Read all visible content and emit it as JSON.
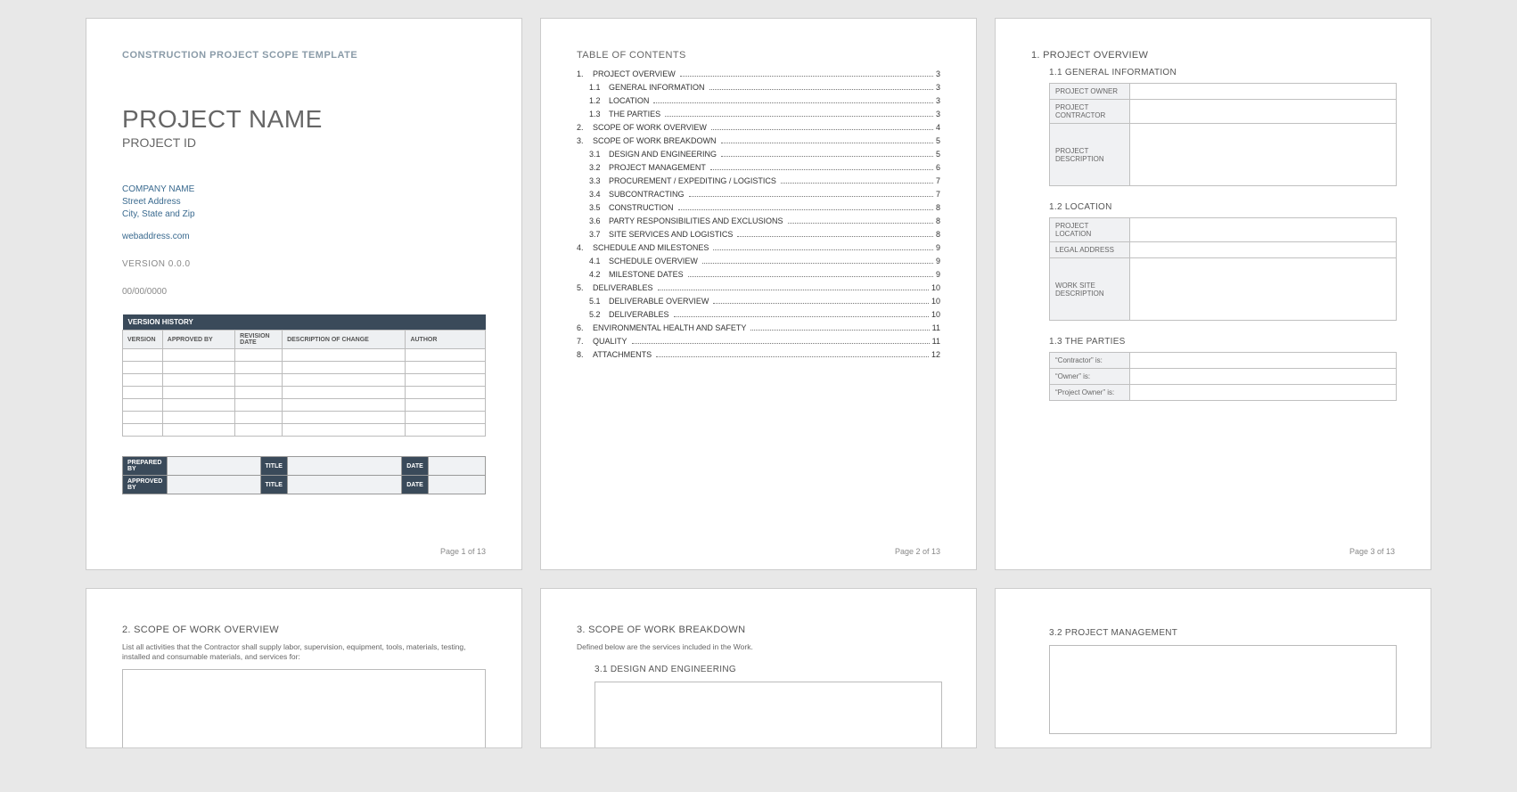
{
  "page1": {
    "template_header": "CONSTRUCTION PROJECT SCOPE TEMPLATE",
    "project_name": "PROJECT NAME",
    "project_id": "PROJECT ID",
    "company_name": "COMPANY NAME",
    "street": "Street Address",
    "city_zip": "City, State and Zip",
    "web": "webaddress.com",
    "version": "VERSION 0.0.0",
    "date": "00/00/0000",
    "vh_title": "VERSION HISTORY",
    "vh_headers": {
      "c1": "VERSION",
      "c2": "APPROVED BY",
      "c3": "REVISION DATE",
      "c4": "DESCRIPTION OF CHANGE",
      "c5": "AUTHOR"
    },
    "sig": {
      "prepared": "PREPARED BY",
      "approved": "APPROVED BY",
      "title": "TITLE",
      "date": "DATE"
    },
    "footer": "Page 1 of 13"
  },
  "toc": {
    "header": "TABLE OF CONTENTS",
    "items": [
      {
        "l": 1,
        "n": "1.",
        "t": "PROJECT OVERVIEW",
        "p": "3"
      },
      {
        "l": 2,
        "n": "1.1",
        "t": "GENERAL INFORMATION",
        "p": "3"
      },
      {
        "l": 2,
        "n": "1.2",
        "t": "LOCATION",
        "p": "3"
      },
      {
        "l": 2,
        "n": "1.3",
        "t": "THE PARTIES",
        "p": "3"
      },
      {
        "l": 1,
        "n": "2.",
        "t": "SCOPE OF WORK OVERVIEW",
        "p": "4"
      },
      {
        "l": 1,
        "n": "3.",
        "t": "SCOPE OF WORK BREAKDOWN",
        "p": "5"
      },
      {
        "l": 2,
        "n": "3.1",
        "t": "DESIGN AND ENGINEERING",
        "p": "5"
      },
      {
        "l": 2,
        "n": "3.2",
        "t": "PROJECT MANAGEMENT",
        "p": "6"
      },
      {
        "l": 2,
        "n": "3.3",
        "t": "PROCUREMENT / EXPEDITING / LOGISTICS",
        "p": "7"
      },
      {
        "l": 2,
        "n": "3.4",
        "t": "SUBCONTRACTING",
        "p": "7"
      },
      {
        "l": 2,
        "n": "3.5",
        "t": "CONSTRUCTION",
        "p": "8"
      },
      {
        "l": 2,
        "n": "3.6",
        "t": "PARTY RESPONSIBILITIES AND EXCLUSIONS",
        "p": "8"
      },
      {
        "l": 2,
        "n": "3.7",
        "t": "SITE SERVICES AND LOGISTICS",
        "p": "8"
      },
      {
        "l": 1,
        "n": "4.",
        "t": "SCHEDULE AND MILESTONES",
        "p": "9"
      },
      {
        "l": 2,
        "n": "4.1",
        "t": "SCHEDULE OVERVIEW",
        "p": "9"
      },
      {
        "l": 2,
        "n": "4.2",
        "t": "MILESTONE DATES",
        "p": "9"
      },
      {
        "l": 1,
        "n": "5.",
        "t": "DELIVERABLES",
        "p": "10"
      },
      {
        "l": 2,
        "n": "5.1",
        "t": "DELIVERABLE OVERVIEW",
        "p": "10"
      },
      {
        "l": 2,
        "n": "5.2",
        "t": "DELIVERABLES",
        "p": "10"
      },
      {
        "l": 1,
        "n": "6.",
        "t": "ENVIRONMENTAL HEALTH AND SAFETY",
        "p": "11"
      },
      {
        "l": 1,
        "n": "7.",
        "t": "QUALITY",
        "p": "11"
      },
      {
        "l": 1,
        "n": "8.",
        "t": "ATTACHMENTS",
        "p": "12"
      }
    ],
    "footer": "Page 2 of 13"
  },
  "page3": {
    "h1": "1.  PROJECT OVERVIEW",
    "s11": "1.1     GENERAL INFORMATION",
    "t11": {
      "owner": "PROJECT OWNER",
      "contractor": "PROJECT CONTRACTOR",
      "desc": "PROJECT DESCRIPTION"
    },
    "s12": "1.2     LOCATION",
    "t12": {
      "loc": "PROJECT LOCATION",
      "legal": "LEGAL ADDRESS",
      "site": "WORK SITE DESCRIPTION"
    },
    "s13": "1.3     THE PARTIES",
    "t13": {
      "contractor": "“Contractor” is:",
      "owner": "“Owner” is:",
      "project_owner": "“Project Owner” is:"
    },
    "footer": "Page 3 of 13"
  },
  "page4": {
    "h1": "2.  SCOPE OF WORK OVERVIEW",
    "note": "List all activities that the Contractor shall supply labor, supervision, equipment, tools, materials, testing, installed and consumable materials, and services for:"
  },
  "page5": {
    "h1": "3.  SCOPE OF WORK BREAKDOWN",
    "note": "Defined below are the services included in the Work.",
    "s31": "3.1     DESIGN AND ENGINEERING"
  },
  "page6": {
    "s32": "3.2     PROJECT MANAGEMENT"
  }
}
